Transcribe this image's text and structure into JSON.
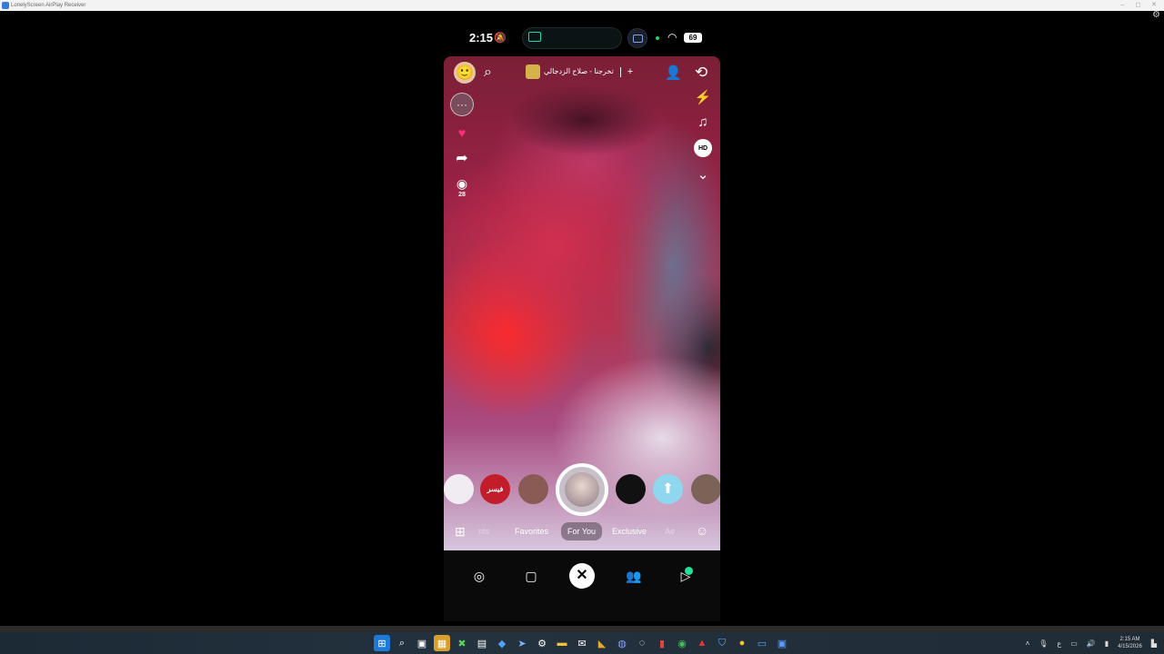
{
  "window": {
    "title": "LonelyScreen AirPlay Receiver",
    "controls": [
      "–",
      "◻",
      "✕"
    ]
  },
  "status_bar": {
    "time": "2:15",
    "battery": "69"
  },
  "snap": {
    "song_title": "تخرجنا - صلاح الزدجالي",
    "song_add": "+",
    "views": "28"
  },
  "lenses": {
    "lens2_text": "فيسر ماهل"
  },
  "tabs": [
    {
      "label": "nts",
      "state": "faded"
    },
    {
      "label": "Favorites",
      "state": "normal"
    },
    {
      "label": "For You",
      "state": "active"
    },
    {
      "label": "Exclusive",
      "state": "normal"
    },
    {
      "label": "Ae",
      "state": "faded"
    }
  ],
  "taskbar": {
    "clock_time": "2:15 AM",
    "clock_date": "4/15/2026",
    "lang": "ع"
  },
  "colors": {
    "accent_teal": "#18d9b0",
    "badge_green": "#21e29a",
    "heart_pink": "#ff2f7a"
  }
}
